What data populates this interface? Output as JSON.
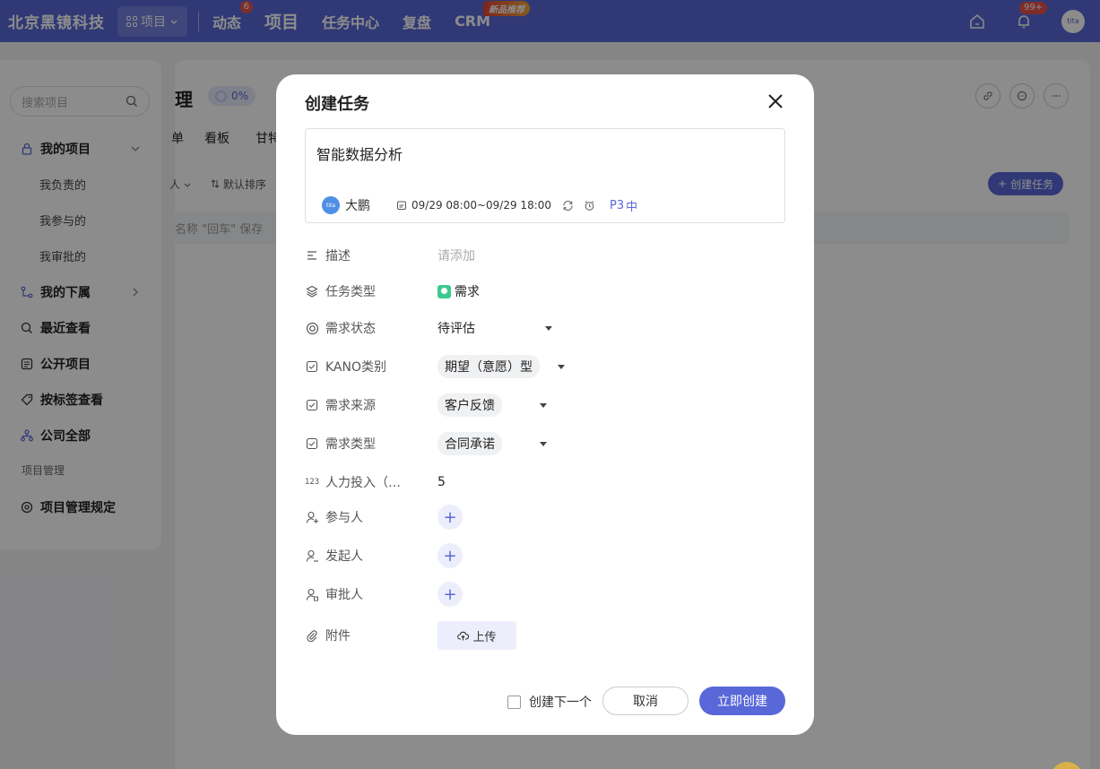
{
  "topbar": {
    "brand": "北京黑镜科技",
    "project_switcher": "项目",
    "nav": [
      {
        "label": "动态",
        "badge": "6"
      },
      {
        "label": "项目"
      },
      {
        "label": "任务中心"
      },
      {
        "label": "复盘"
      },
      {
        "label": "CRM",
        "tag": "新品推荐"
      }
    ],
    "notification_badge": "99+",
    "avatar_text": "tita",
    "brand_color": "#5868d8"
  },
  "sidebar": {
    "search_placeholder": "搜索项目",
    "my_projects": "我的项目",
    "my_projects_children": [
      "我负责的",
      "我参与的",
      "我审批的"
    ],
    "subordinates": "我的下属",
    "recent": "最近查看",
    "public": "公开项目",
    "by_tag": "按标签查看",
    "company_all": "公司全部",
    "group_label": "项目管理",
    "rules": "项目管理规定"
  },
  "content": {
    "title": "理",
    "progress": "0%",
    "tabs": [
      "单",
      "看板",
      "甘特"
    ],
    "filter_1": "人",
    "sort_label": "默认排序",
    "create_task": "创建任务",
    "hint_text": "名称 \"回车\" 保存"
  },
  "modal": {
    "title": "创建任务",
    "task_name": "智能数据分析",
    "assignee_avatar": "tita",
    "assignee": "大鹏",
    "date_range": "09/29 08:00~09/29 18:00",
    "priority_code": "P3",
    "priority_label": "中",
    "fields": {
      "description": {
        "label": "描述",
        "placeholder": "请添加"
      },
      "task_type": {
        "label": "任务类型",
        "value": "需求"
      },
      "req_status": {
        "label": "需求状态",
        "value": "待评估"
      },
      "kano": {
        "label": "KANO类别",
        "value": "期望（意愿）型"
      },
      "req_source": {
        "label": "需求来源",
        "value": "客户反馈"
      },
      "req_type": {
        "label": "需求类型",
        "value": "合同承诺"
      },
      "effort": {
        "label": "人力投入（…",
        "value": "5"
      },
      "participants": {
        "label": "参与人"
      },
      "initiator": {
        "label": "发起人"
      },
      "approver": {
        "label": "审批人"
      },
      "attachment": {
        "label": "附件",
        "button": "上传"
      }
    },
    "create_next": "创建下一个",
    "cancel": "取消",
    "submit": "立即创建"
  }
}
